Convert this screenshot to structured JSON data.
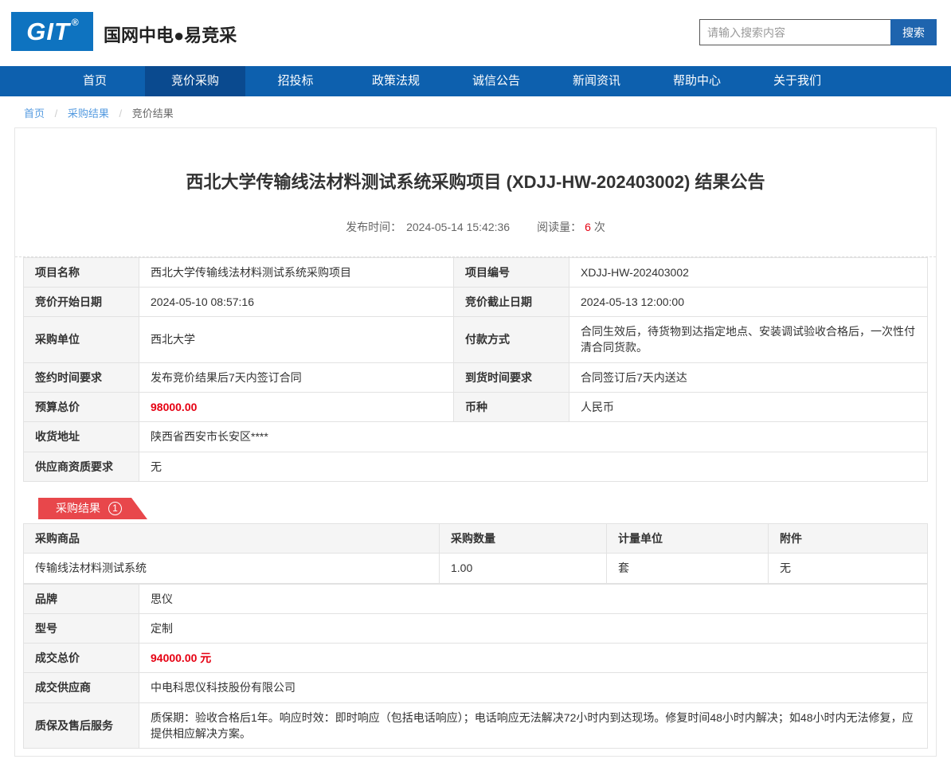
{
  "header": {
    "logo": {
      "text": "GIT",
      "reg": "®"
    },
    "site_name": "国网中电●易竞采",
    "search": {
      "placeholder": "请输入搜索内容",
      "button_label": "搜索"
    }
  },
  "nav": {
    "items": [
      {
        "label": "首页",
        "active": false
      },
      {
        "label": "竞价采购",
        "active": true
      },
      {
        "label": "招投标",
        "active": false
      },
      {
        "label": "政策法规",
        "active": false
      },
      {
        "label": "诚信公告",
        "active": false
      },
      {
        "label": "新闻资讯",
        "active": false
      },
      {
        "label": "帮助中心",
        "active": false
      },
      {
        "label": "关于我们",
        "active": false
      }
    ]
  },
  "breadcrumb": {
    "home": "首页",
    "section": "采购结果",
    "current": "竞价结果",
    "separator": "/"
  },
  "article": {
    "title": "西北大学传输线法材料测试系统采购项目 (XDJJ-HW-202403002) 结果公告",
    "publish_label": "发布时间：",
    "publish_time": "2024-05-14 15:42:36",
    "views_label": "阅读量：",
    "views_count": "6",
    "views_unit": "次"
  },
  "info_table": {
    "rows4col": [
      {
        "label1": "项目名称",
        "value1": "西北大学传输线法材料测试系统采购项目",
        "label2": "项目编号",
        "value2": "XDJJ-HW-202403002"
      },
      {
        "label1": "竞价开始日期",
        "value1": "2024-05-10 08:57:16",
        "label2": "竞价截止日期",
        "value2": "2024-05-13 12:00:00"
      },
      {
        "label1": "采购单位",
        "value1": "西北大学",
        "label2": "付款方式",
        "value2": "合同生效后，待货物到达指定地点、安装调试验收合格后，一次性付清合同货款。"
      },
      {
        "label1": "签约时间要求",
        "value1": "发布竞价结果后7天内签订合同",
        "label2": "到货时间要求",
        "value2": "合同签订后7天内送达"
      },
      {
        "label1": "预算总价",
        "value1": "98000.00",
        "label2": "币种",
        "value2": "人民币"
      }
    ],
    "rows_full": [
      {
        "label": "收货地址",
        "value": "陕西省西安市长安区****"
      },
      {
        "label": "供应商资质要求",
        "value": "无"
      }
    ]
  },
  "result_section": {
    "badge_label": "采购结果",
    "badge_number": "1",
    "table": {
      "headers": [
        "采购商品",
        "采购数量",
        "计量单位",
        "附件"
      ],
      "product_row": [
        "传输线法材料测试系统",
        "1.00",
        "套",
        "无"
      ],
      "detail_rows": [
        {
          "label": "品牌",
          "value": "思仪"
        },
        {
          "label": "型号",
          "value": "定制"
        },
        {
          "label": "成交总价",
          "value": "94000.00 元"
        },
        {
          "label": "成交供应商",
          "value": "中电科思仪科技股份有限公司"
        },
        {
          "label": "质保及售后服务",
          "value": "质保期：验收合格后1年。响应时效：即时响应（包括电话响应）；电话响应无法解决72小时内到达现场。修复时间48小时内解决；如48小时内无法修复，应提供相应解决方案。"
        }
      ]
    }
  },
  "colors": {
    "logo_blue": "#0e73c0",
    "nav_blue": "#0d60ae",
    "nav_active_blue": "#0a4a8f",
    "search_button_blue": "#1e64ae",
    "link_blue": "#559be0",
    "price_red": "#e60012",
    "badge_red": "#e8474b"
  }
}
